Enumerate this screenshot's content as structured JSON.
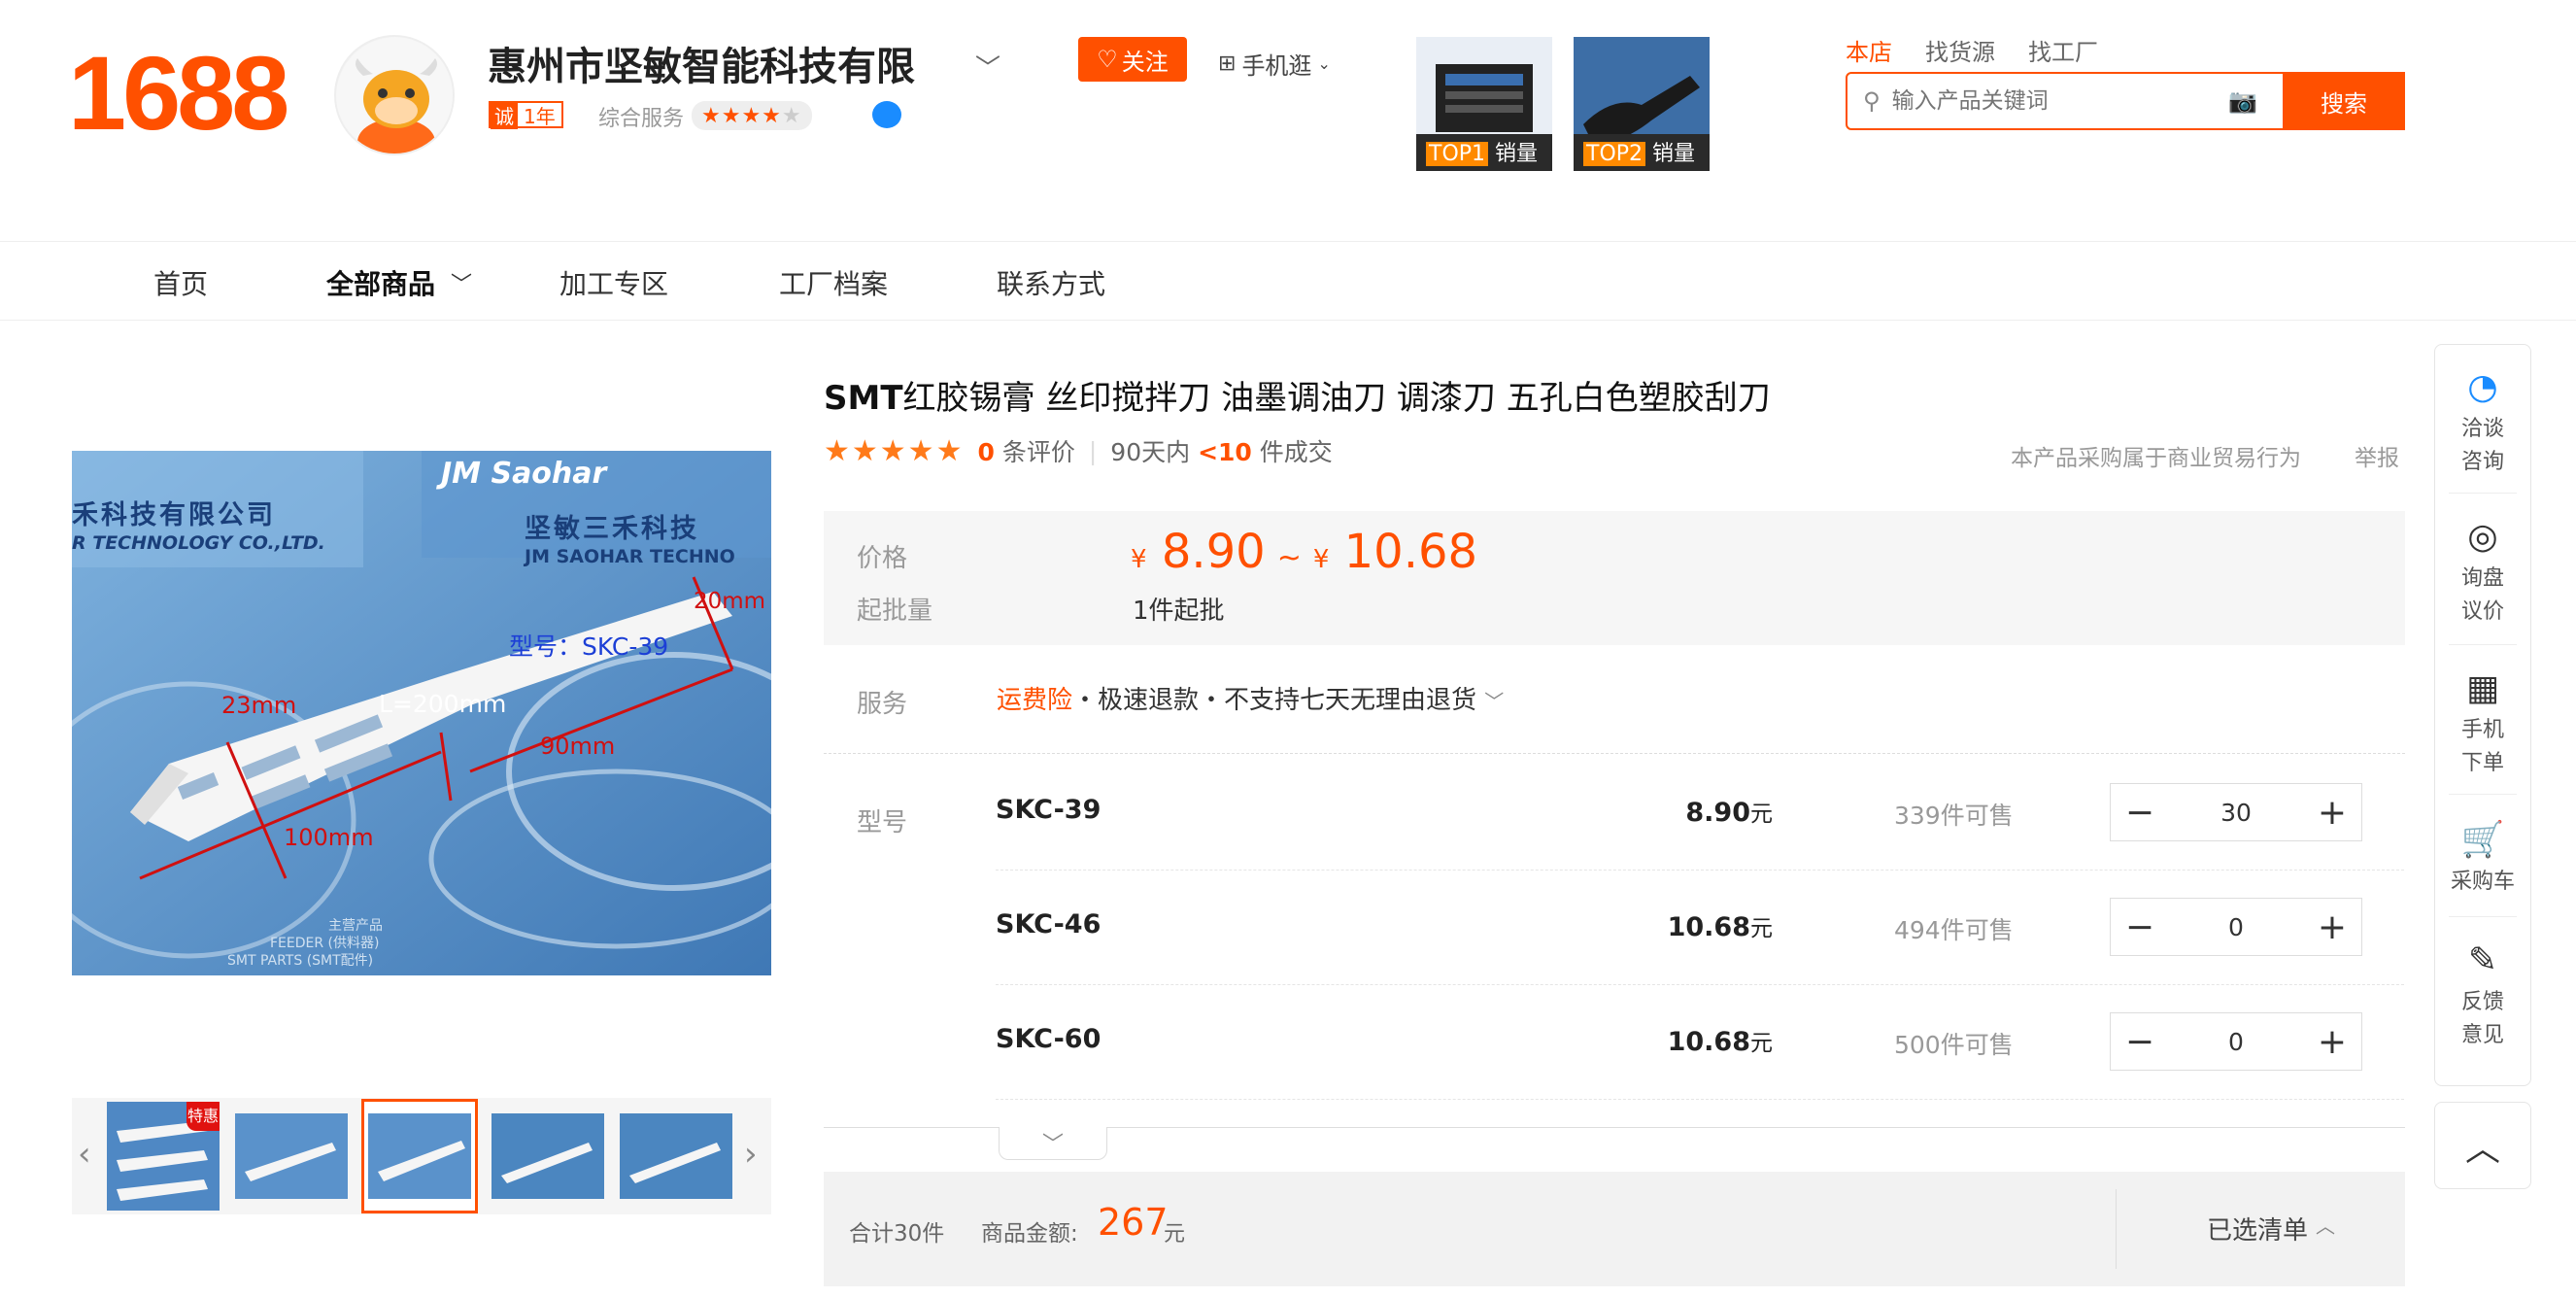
{
  "header": {
    "logo": "1688",
    "shop_name": "惠州市坚敏智能科技有限",
    "cheng_badge": "诚",
    "years": "1年",
    "service_label": "综合服务",
    "follow_label": "关注",
    "mobile_shop_label": "手机逛",
    "top_items": [
      {
        "rank": "TOP1",
        "label": "销量"
      },
      {
        "rank": "TOP2",
        "label": "销量"
      }
    ],
    "search_tabs": [
      "本店",
      "找货源",
      "找工厂"
    ],
    "search_placeholder": "输入产品关键词",
    "search_button": "搜索"
  },
  "nav": {
    "items": [
      "首页",
      "全部商品",
      "加工专区",
      "工厂档案",
      "联系方式"
    ]
  },
  "product": {
    "title_bold": "SMT",
    "title_rest": "红胶锡膏 丝印搅拌刀 油墨调油刀 调漆刀 五孔白色塑胶刮刀",
    "review_count": "0",
    "review_label": "条评价",
    "days_label": "90天内",
    "sold_count": "<10",
    "sold_label": "件成交",
    "biz_note": "本产品采购属于商业贸易行为",
    "report": "举报",
    "price_label": "价格",
    "currency": "¥",
    "price_min": "8.90",
    "price_tilde": "~",
    "price_max": "10.68",
    "moq_label": "起批量",
    "moq_value": "1件起批",
    "service_label": "服务",
    "service_insurance": "运费险",
    "service_rest": "・极速退款・不支持七天无理由退货",
    "model_label": "型号"
  },
  "image": {
    "brand_text": "JM Saohar",
    "company_cn": "坚敏三禾科技",
    "company_cn_left": "禾科技有限公司",
    "company_en": "JM SAOHAR TECHNO",
    "company_en_left": "R TECHNOLOGY CO.,LTD.",
    "model_text": "型号：SKC-39",
    "dim_total": "L=200mm",
    "dim_width": "23mm",
    "dim_tip": "20mm",
    "dim_handle": "100mm",
    "dim_blade": "90mm",
    "footer_1": "主营产品",
    "footer_2": "FEEDER (供料器)",
    "footer_3": "SMT PARTS (SMT配件)",
    "special_tag": "特惠"
  },
  "skus": [
    {
      "name": "SKC-39",
      "price": "8.90",
      "unit": "元",
      "stock": "339件可售",
      "qty": "30"
    },
    {
      "name": "SKC-46",
      "price": "10.68",
      "unit": "元",
      "stock": "494件可售",
      "qty": "0"
    },
    {
      "name": "SKC-60",
      "price": "10.68",
      "unit": "元",
      "stock": "500件可售",
      "qty": "0"
    }
  ],
  "summary": {
    "total_count": "合计30件",
    "amount_label": "商品金额:",
    "amount_value": "267",
    "amount_unit": "元",
    "selected_list": "已选清单"
  },
  "rail": [
    {
      "icon": "chat-icon",
      "label_1": "洽谈",
      "label_2": "咨询"
    },
    {
      "icon": "target-icon",
      "label_1": "询盘",
      "label_2": "议价"
    },
    {
      "icon": "qr-icon",
      "label_1": "手机",
      "label_2": "下单"
    },
    {
      "icon": "cart-icon",
      "label_1": "采购车",
      "label_2": ""
    },
    {
      "icon": "edit-icon",
      "label_1": "反馈",
      "label_2": "意见"
    }
  ],
  "colors": {
    "accent": "#ff5000",
    "text": "#333333",
    "muted": "#999999"
  }
}
